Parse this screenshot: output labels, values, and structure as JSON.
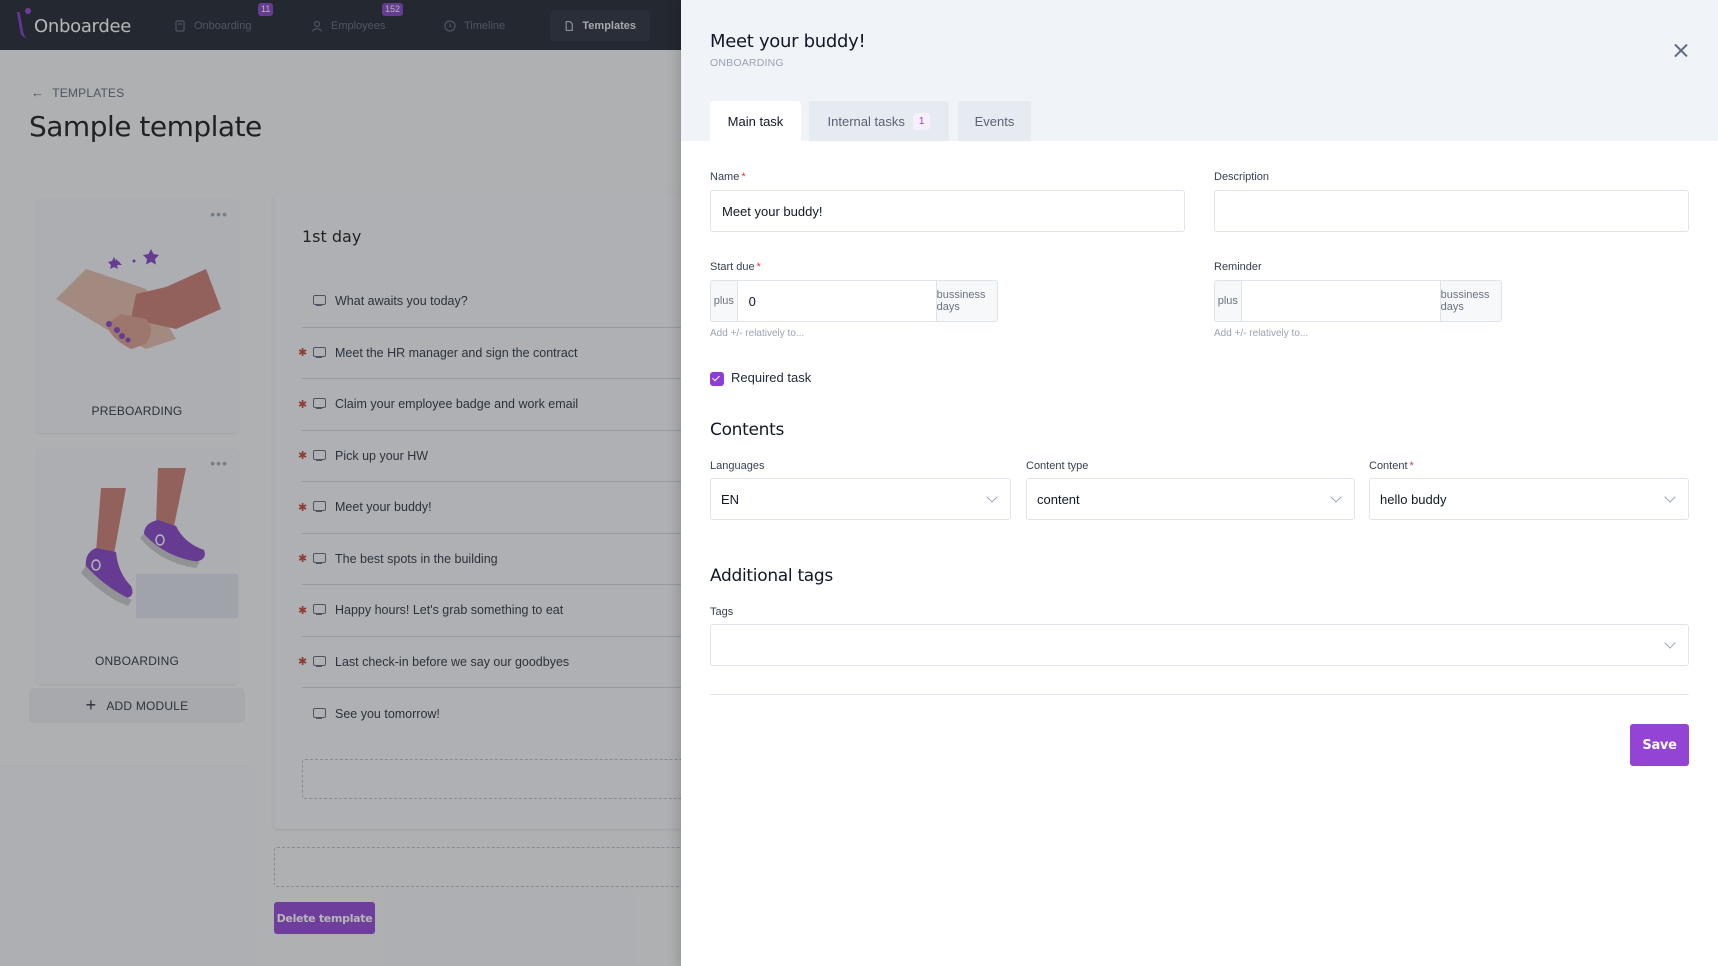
{
  "app": {
    "name": "Onboardee",
    "nav": [
      {
        "label": "Onboarding",
        "icon": "clipboard-icon",
        "badge": "11"
      },
      {
        "label": "Employees",
        "icon": "user-icon",
        "badge": "152"
      },
      {
        "label": "Timeline",
        "icon": "clock-icon",
        "badge": null
      },
      {
        "label": "Templates",
        "icon": "file-icon",
        "badge": null,
        "active": true
      }
    ]
  },
  "page": {
    "breadcrumb": "TEMPLATES",
    "title": "Sample template",
    "modules": [
      {
        "label": "PREBOARDING",
        "illustration": "handshake"
      },
      {
        "label": "ONBOARDING",
        "illustration": "sneakers-steps"
      }
    ],
    "add_module_label": "ADD MODULE",
    "day": {
      "title": "1st day",
      "tasks": [
        {
          "label": "What awaits you today?",
          "required": false
        },
        {
          "label": "Meet the HR manager and sign the contract",
          "required": true
        },
        {
          "label": "Claim your employee badge and work email",
          "required": true
        },
        {
          "label": "Pick up your HW",
          "required": true
        },
        {
          "label": "Meet your buddy!",
          "required": true
        },
        {
          "label": "The best spots in the building",
          "required": true
        },
        {
          "label": "Happy hours! Let's grab something to eat",
          "required": true
        },
        {
          "label": "Last check-in before we say our goodbyes",
          "required": true
        },
        {
          "label": "See you tomorrow!",
          "required": false
        }
      ]
    },
    "delete_label": "Delete template"
  },
  "drawer": {
    "title": "Meet your buddy!",
    "subtitle": "ONBOARDING",
    "tabs": [
      {
        "label": "Main task",
        "active": true
      },
      {
        "label": "Internal tasks",
        "badge": "1"
      },
      {
        "label": "Events"
      }
    ],
    "form": {
      "name_label": "Name",
      "name_value": "Meet your buddy!",
      "description_label": "Description",
      "description_value": "",
      "start_due_label": "Start due",
      "start_due_prefix": "plus",
      "start_due_value": "0",
      "start_due_suffix": "bussiness days",
      "start_due_help": "Add +/- relatively to...",
      "reminder_label": "Reminder",
      "reminder_prefix": "plus",
      "reminder_value": "",
      "reminder_suffix": "bussiness days",
      "reminder_help": "Add +/- relatively to...",
      "required_label": "Required task",
      "required_checked": true
    },
    "contents": {
      "title": "Contents",
      "languages_label": "Languages",
      "languages_value": "EN",
      "content_type_label": "Content type",
      "content_type_value": "content",
      "content_label": "Content",
      "content_value": "hello buddy"
    },
    "tags": {
      "title": "Additional tags",
      "label": "Tags",
      "value": ""
    },
    "save_label": "Save"
  },
  "colors": {
    "accent": "#8e3ed6",
    "nav_bg": "#151b27",
    "required_star": "#e0344b"
  }
}
